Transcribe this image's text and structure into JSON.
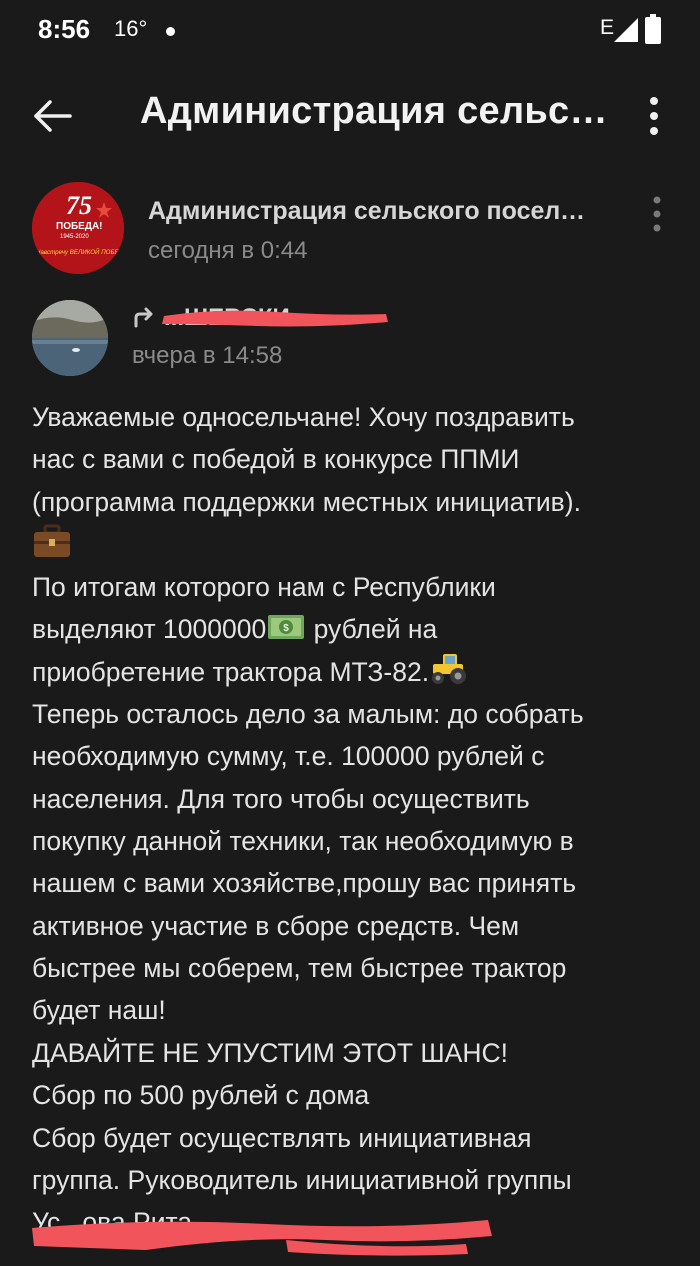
{
  "status_bar": {
    "time": "8:56",
    "temperature": "16°",
    "network": "E"
  },
  "app_bar": {
    "title": "Администрация сельского поселения"
  },
  "post": {
    "group_name": "Администрация сельского поселения",
    "time": "сегодня в 0:44",
    "avatar_text_top": "75",
    "avatar_text_mid": "ПОБЕДА!",
    "avatar_text_years": "1945-2020",
    "avatar_text_bottom": "Навстречу ВЕЛИКОЙ ПОБЕДЕ!"
  },
  "repost": {
    "author": "...ШЕВСКИ",
    "time": "вчера в 14:58"
  },
  "body": {
    "line1": "Уважаемые односельчане! Хочу поздравить",
    "line2": "нас с вами с победой в конкурсе ППМИ",
    "line3": "(программа поддержки местных инициатив).",
    "line5": "По итогам которого нам  с Республики",
    "line6a": "выделяют 1000000",
    "line6b": " рублей на",
    "line7": "приобретение трактора МТЗ-82.",
    "line8": "Теперь осталось дело за малым: до собрать",
    "line9": "необходимую сумму, т.е. 100000 рублей с",
    "line10": "населения. Для того чтобы осуществить",
    "line11": "покупку данной техники, так необходимую в",
    "line12": "нашем с вами хозяйстве,прошу вас принять",
    "line13": "активное участие в сборе средств. Чем",
    "line14": "быстрее мы соберем, тем быстрее трактор",
    "line15": "будет наш!",
    "line16": "ДАВАЙТЕ НЕ УПУСТИМ ЭТОТ ШАНС!",
    "line17": "Сбор по 500 рублей с дома",
    "line18": "Сбор будет осуществлять инициативная",
    "line19": "группа. Руководитель инициативной группы",
    "line20": "Ус...ова Рита..."
  },
  "colors": {
    "background": "#1a1a1a",
    "text": "#e4e4e4",
    "secondary_text": "#8a8a8a",
    "redaction": "#f2545b"
  },
  "icons": {
    "back": "arrow-left-icon",
    "more": "more-vertical-icon",
    "repost": "repost-arrow-icon",
    "briefcase": "briefcase-emoji",
    "money": "dollar-banknote-emoji",
    "tractor": "tractor-emoji"
  }
}
